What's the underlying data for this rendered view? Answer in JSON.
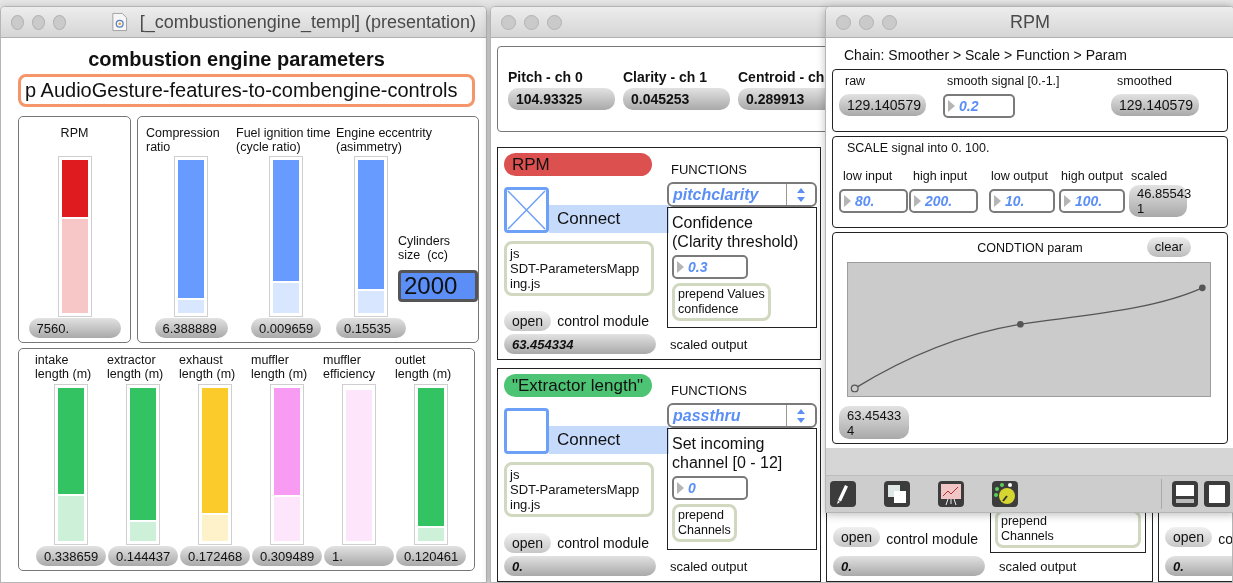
{
  "left_window": {
    "title": "[_combustionengine_templ] (presentation)",
    "heading": "combustion engine parameters",
    "subpatcher": "p AudioGesture-features-to-combengine-controls",
    "engine_panel": {
      "sliders": [
        {
          "label": "RPM",
          "value": "7560.",
          "level": 0.63,
          "color": "#f7c6c7"
        }
      ]
    },
    "geometry_panel": {
      "sliders": [
        {
          "label": "Compression\nratio",
          "value": "6.388889",
          "level": 0.1,
          "color": "#d9e6ff"
        },
        {
          "label": "Fuel ignition time\n(cycle ratio)",
          "value": "0.009659",
          "level": 0.21,
          "color": "#d9e6ff"
        },
        {
          "label": "Engine eccentrity\n(asimmetry)",
          "value": "0.15535",
          "level": 0.16,
          "color": "#d9e6ff"
        }
      ],
      "cylinders": {
        "label": "Cylinders\nsize  (cc)",
        "value": "2000"
      }
    },
    "ducts_panel": {
      "sliders": [
        {
          "label": "intake\nlength (m)",
          "value": "0.338659",
          "level": 0.31,
          "color": "#ccf0d8"
        },
        {
          "label": "extractor\nlength (m)",
          "value": "0.144437",
          "level": 0.14,
          "color": "#ccf0d8"
        },
        {
          "label": "exhaust\nlength (m)",
          "value": "0.172468",
          "level": 0.18,
          "color": "#fef2ca"
        },
        {
          "label": "muffler\nlength (m)",
          "value": "0.309489",
          "level": 0.3,
          "color": "#fde6fc"
        },
        {
          "label": "muffler\nefficiency",
          "value": "1.",
          "level": 1,
          "color": "#fde6fc"
        },
        {
          "label": "outlet\nlength (m)",
          "value": "0.120461",
          "level": 0.1,
          "color": "#ccf0d8"
        }
      ]
    }
  },
  "mapping_window": {
    "features": [
      {
        "label": "Pitch - ch 0",
        "value": "104.93325"
      },
      {
        "label": "Clarity - ch 1",
        "value": "0.045253"
      },
      {
        "label": "Centroid - ch",
        "value": "0.289913"
      }
    ],
    "modules": [
      {
        "label": "RPM",
        "color": "#dc5050",
        "checked": true,
        "connect": "Connect",
        "script": "js\nSDT-ParametersMapp\ning.js",
        "open": "open",
        "module_label": "control module",
        "output": "63.454334",
        "output_label": "scaled output",
        "functions_label": "FUNCTIONS",
        "function": "pitchclarity",
        "param_label": "Confidence\n(Clarity threshold)",
        "param_value": "0.3",
        "prepend": "prepend Values\nconfidence"
      },
      {
        "label": "\"Extractor length\"",
        "color": "#4cc474",
        "checked": false,
        "connect": "Connect",
        "script": "js\nSDT-ParametersMapp\ning.js",
        "open": "open",
        "module_label": "control module",
        "output": "0.",
        "output_label": "scaled output",
        "functions_label": "FUNCTIONS",
        "function": "passthru",
        "param_label": "Set incoming\nchannel [0 - 12]",
        "param_value": "0",
        "prepend": "prepend\nChannels"
      }
    ],
    "partial_modules": [
      {
        "open": "open",
        "module_label": "control module",
        "prepend": "prepend\nChannels",
        "output": "0.",
        "output_label": "scaled output"
      },
      {
        "open": "open",
        "module_label": "co",
        "output": "0."
      }
    ]
  },
  "rpm_window": {
    "title": "RPM",
    "chain": "Chain:  Smoother > Scale > Function > Param",
    "smoother": {
      "raw_label": "raw",
      "raw": "129.140579",
      "smooth_label": "smooth signal [0.-1.]",
      "smooth": "0.2",
      "smoothed_label": "smoothed",
      "smoothed": "129.140579"
    },
    "scale": {
      "title": "SCALE signal into 0. 100.",
      "inputs": [
        {
          "label": "low input",
          "value": "80."
        },
        {
          "label": "high input",
          "value": "200."
        },
        {
          "label": "low output",
          "value": "10."
        },
        {
          "label": "high output",
          "value": "100."
        }
      ],
      "scaled_label": "scaled",
      "scaled": "46.85543\n1"
    },
    "condition": {
      "title": "CONDTION param",
      "clear": "clear",
      "output": "63.45433\n4"
    }
  }
}
